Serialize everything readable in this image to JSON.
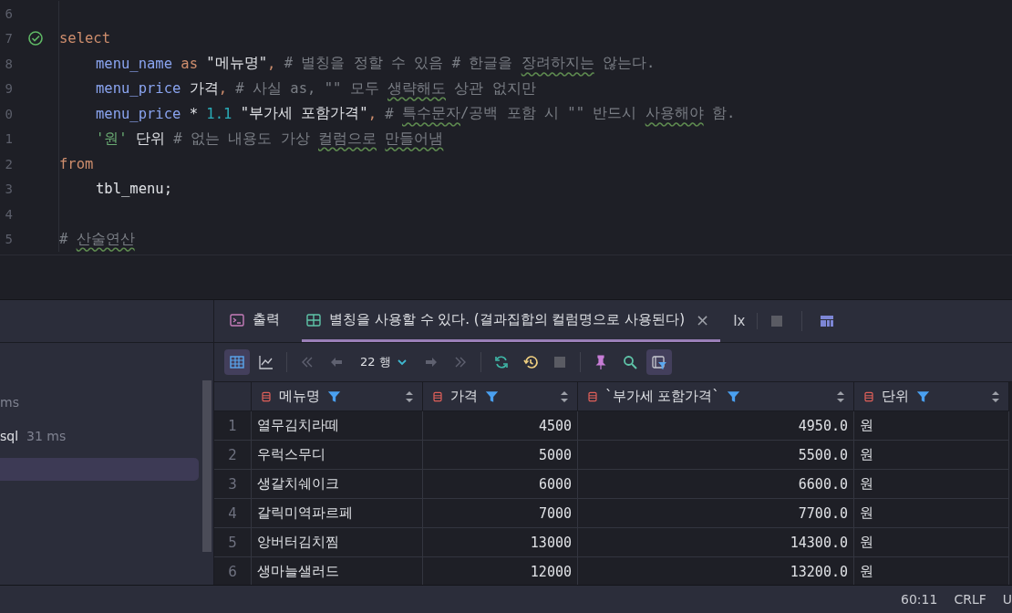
{
  "editor": {
    "lines": [
      {
        "number": "6"
      },
      {
        "number": "7",
        "check": true,
        "tokens": [
          {
            "kind": "keyword",
            "text": "select"
          }
        ]
      },
      {
        "number": "8",
        "indent": true,
        "tokens": [
          {
            "kind": "ident",
            "text": "menu_name "
          },
          {
            "kind": "keyword",
            "text": "as "
          },
          {
            "kind": "string",
            "text": "\"메뉴명\""
          },
          {
            "kind": "keyword",
            "text": ", "
          },
          {
            "kind": "comment",
            "text": "# 별칭을 정할 수 있음 # 한글을 "
          },
          {
            "kind": "typo",
            "text": "장려하지는"
          },
          {
            "kind": "comment",
            "text": " 않는다."
          }
        ]
      },
      {
        "number": "9",
        "indent": true,
        "tokens": [
          {
            "kind": "ident",
            "text": "menu_price "
          },
          {
            "kind": "plain",
            "text": "가격"
          },
          {
            "kind": "keyword",
            "text": ", "
          },
          {
            "kind": "comment",
            "text": "# 사실 as, \"\" 모두 "
          },
          {
            "kind": "typo",
            "text": "생략해도"
          },
          {
            "kind": "comment",
            "text": " 상관 없지만"
          }
        ]
      },
      {
        "number": "0",
        "indent": true,
        "tokens": [
          {
            "kind": "ident",
            "text": "menu_price "
          },
          {
            "kind": "plain",
            "text": "* "
          },
          {
            "kind": "number",
            "text": "1.1 "
          },
          {
            "kind": "string",
            "text": "\"부가세 포함가격\""
          },
          {
            "kind": "keyword",
            "text": ", "
          },
          {
            "kind": "comment",
            "text": "# "
          },
          {
            "kind": "typo",
            "text": "특수문자"
          },
          {
            "kind": "comment",
            "text": "/공백 포함 시 \"\" 반드시 "
          },
          {
            "kind": "typo",
            "text": "사용해야"
          },
          {
            "kind": "comment",
            "text": " 함."
          }
        ]
      },
      {
        "number": "1",
        "indent": true,
        "tokens": [
          {
            "kind": "literal",
            "text": "'원' "
          },
          {
            "kind": "plain",
            "text": "단위 "
          },
          {
            "kind": "comment",
            "text": "# 없는 내용도 가상 "
          },
          {
            "kind": "typo",
            "text": "컬럼으로"
          },
          {
            "kind": "typo",
            "text": "만들어냄",
            "space_before": true
          }
        ]
      },
      {
        "number": "2",
        "indent": false,
        "tokens": [
          {
            "kind": "keyword",
            "text": "from"
          }
        ]
      },
      {
        "number": "3",
        "indent": true,
        "tokens": [
          {
            "kind": "plain",
            "text": "tbl_menu;"
          }
        ]
      },
      {
        "number": "4"
      },
      {
        "number": "5",
        "indent": false,
        "tokens": [
          {
            "kind": "comment",
            "text": "# "
          },
          {
            "kind": "typo",
            "text": "산술연산"
          }
        ]
      }
    ]
  },
  "sidebar": {
    "items": [
      {
        "time": "ms",
        "selected": false
      },
      {
        "name": "sql",
        "time": "31 ms",
        "selected": false
      },
      {
        "selected": true
      }
    ]
  },
  "tabs": [
    {
      "kind": "output",
      "label": "출력",
      "selected": false
    },
    {
      "kind": "table",
      "label": "별칭을 사용할 수 있다. (결과집합의 컬럼명으로 사용된다)",
      "selected": true,
      "close": "×"
    }
  ],
  "tab_extra": "Ix",
  "toolbar": {
    "table_view_selected": true,
    "row_count": "22 행",
    "filter_view_selected": true
  },
  "table": {
    "columns": [
      {
        "name": "메뉴명",
        "kind": "text"
      },
      {
        "name": "가격",
        "kind": "number"
      },
      {
        "name": "`부가세 포함가격`",
        "kind": "number"
      },
      {
        "name": "단위",
        "kind": "text"
      }
    ],
    "rows": [
      {
        "number": "1",
        "cells": [
          "열무김치라떼",
          "4500",
          "4950.0",
          "원"
        ]
      },
      {
        "number": "2",
        "cells": [
          "우럭스무디",
          "5000",
          "5500.0",
          "원"
        ]
      },
      {
        "number": "3",
        "cells": [
          "생갈치쉐이크",
          "6000",
          "6600.0",
          "원"
        ]
      },
      {
        "number": "4",
        "cells": [
          "갈릭미역파르페",
          "7000",
          "7700.0",
          "원"
        ]
      },
      {
        "number": "5",
        "cells": [
          "앙버터김치찜",
          "13000",
          "14300.0",
          "원"
        ]
      },
      {
        "number": "6",
        "cells": [
          "생마늘샐러드",
          "12000",
          "13200.0",
          "원"
        ]
      }
    ]
  },
  "status_bar": {
    "position": "60:11",
    "line_ending": "CRLF",
    "encoding": "U"
  }
}
